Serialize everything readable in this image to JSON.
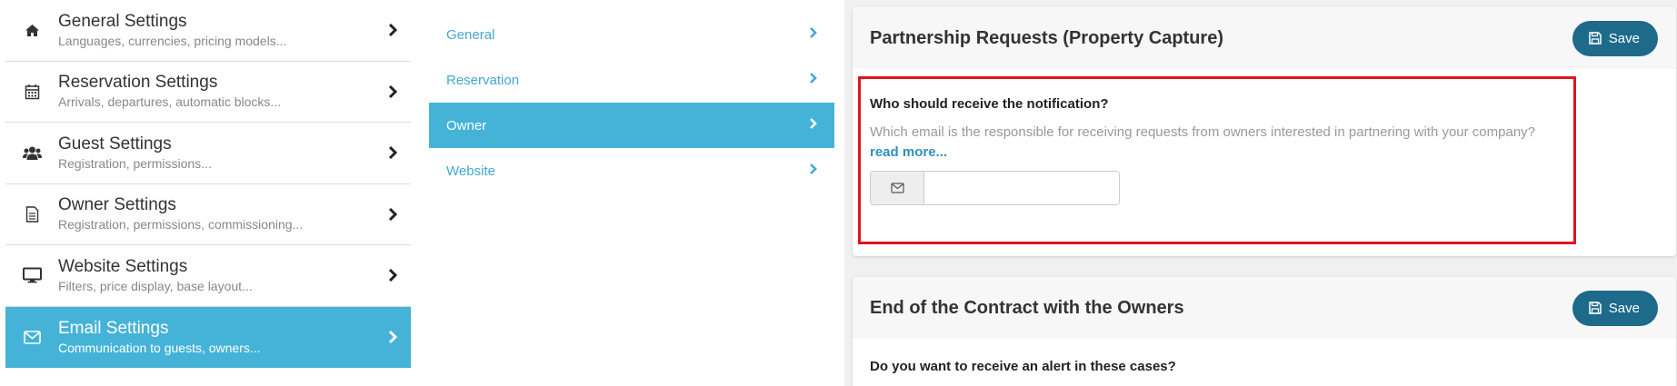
{
  "left_menu": {
    "items": [
      {
        "title": "General Settings",
        "subtitle": "Languages, currencies, pricing models...",
        "icon": "home-icon"
      },
      {
        "title": "Reservation Settings",
        "subtitle": "Arrivals, departures, automatic blocks...",
        "icon": "calendar-icon"
      },
      {
        "title": "Guest Settings",
        "subtitle": "Registration, permissions...",
        "icon": "users-icon"
      },
      {
        "title": "Owner Settings",
        "subtitle": "Registration, permissions, commissioning...",
        "icon": "document-icon"
      },
      {
        "title": "Website Settings",
        "subtitle": "Filters, price display, base layout...",
        "icon": "monitor-icon"
      },
      {
        "title": "Email Settings",
        "subtitle": "Communication to guests, owners...",
        "icon": "envelope-icon",
        "active": true
      }
    ]
  },
  "sub_menu": {
    "items": [
      {
        "label": "General"
      },
      {
        "label": "Reservation"
      },
      {
        "label": "Owner",
        "active": true
      },
      {
        "label": "Website"
      }
    ]
  },
  "partnership": {
    "title": "Partnership Requests (Property Capture)",
    "save_label": "Save",
    "question": "Who should receive the notification?",
    "description": "Which email is the responsible for receiving requests from owners interested in partnering with your company?",
    "read_more": "read more...",
    "email_value": "",
    "email_placeholder": ""
  },
  "contract_end": {
    "title": "End of the Contract with the Owners",
    "save_label": "Save",
    "question": "Do you want to receive an alert in these cases?"
  },
  "colors": {
    "accent": "#45b3d8",
    "button": "#1e6a8a",
    "highlight_border": "#e0141e",
    "link": "#2f8fc2"
  }
}
